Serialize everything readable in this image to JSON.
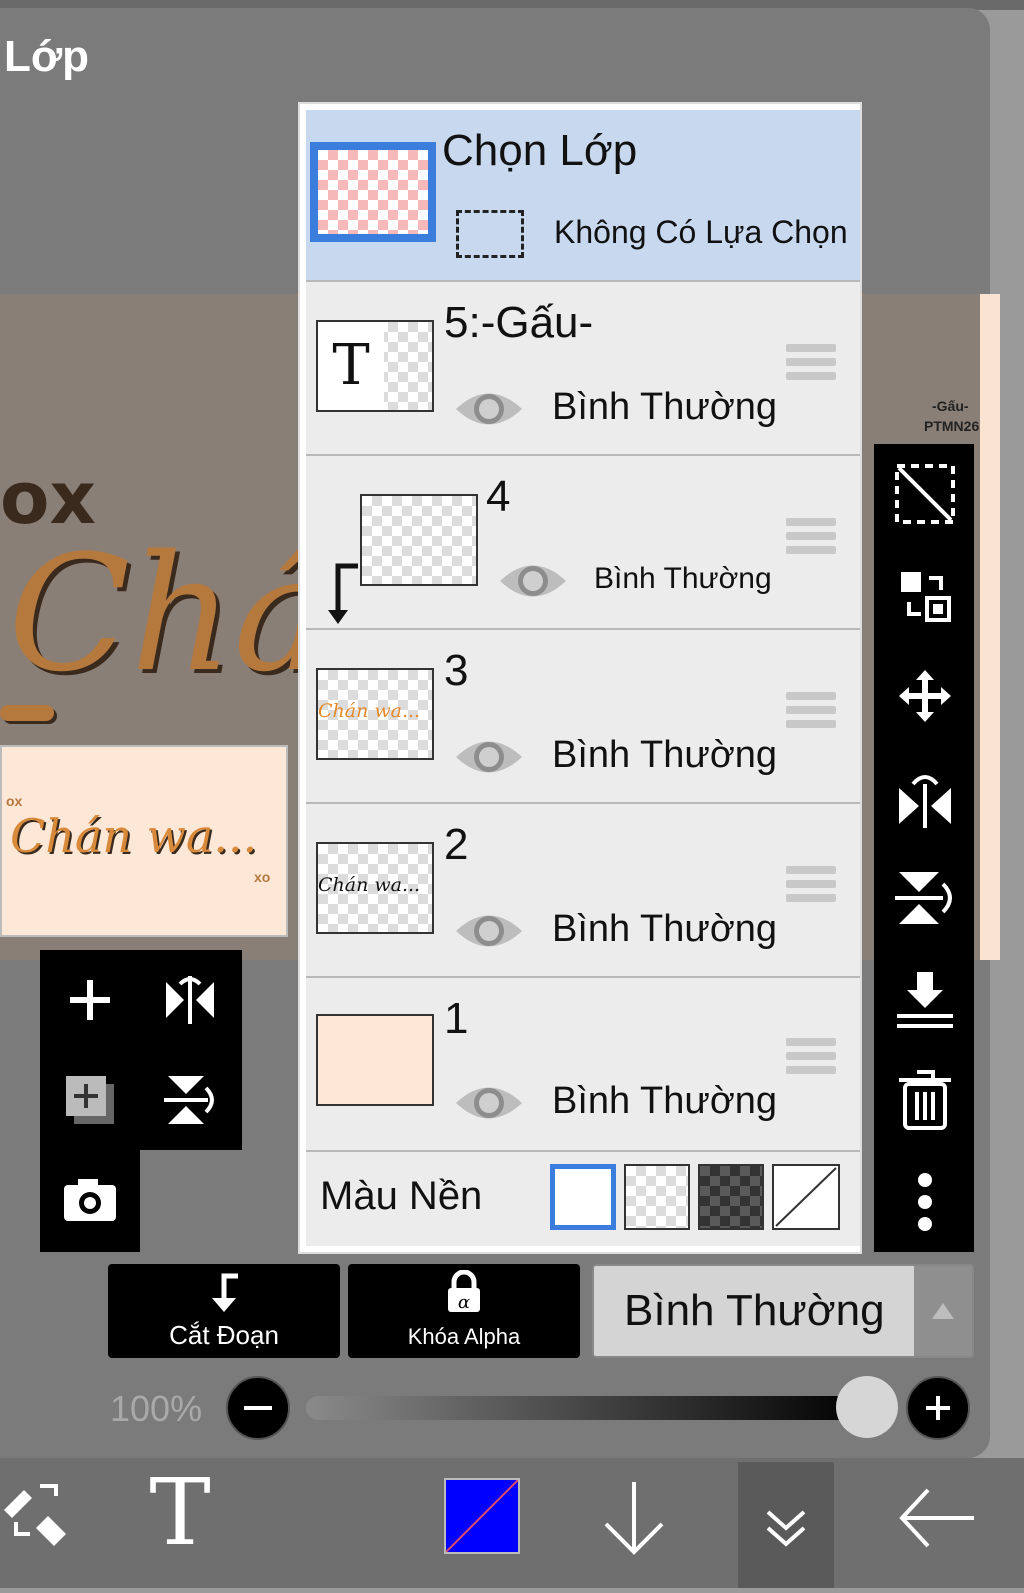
{
  "header": {
    "title": "Lớp"
  },
  "canvas": {
    "ox_text": "ox",
    "cho_text": "Chá",
    "preview_text": "Chán wa...",
    "preview_ox": "ox",
    "preview_xo": "xo",
    "side_label_1": "-Gấu-",
    "side_label_2": "PTMN26"
  },
  "selection": {
    "title": "Chọn Lớp",
    "status": "Không Có Lựa Chọn"
  },
  "layers": [
    {
      "name": "5:-Gấu-",
      "mode": "Bình Thường",
      "thumb_text": "T"
    },
    {
      "name": "4",
      "mode": "Bình Thường"
    },
    {
      "name": "3",
      "mode": "Bình Thường",
      "thumb_text": "Chán wa..."
    },
    {
      "name": "2",
      "mode": "Bình Thường",
      "thumb_text": "Chán wa..."
    },
    {
      "name": "1",
      "mode": "Bình Thường"
    }
  ],
  "background": {
    "label": "Màu Nền"
  },
  "bottom_controls": {
    "clip_label": "Cắt Đoạn",
    "alpha_lock_label": "Khóa Alpha",
    "blend_mode": "Bình Thường",
    "opacity_label": "100%",
    "opacity": 1.0
  },
  "colors": {
    "accent_blue": "#3a7ddc",
    "selection_bg": "#c8d8ee",
    "layer1_fill": "#fde8d8",
    "toolbar_bg": "#000000",
    "primary_color": "#0000ff"
  },
  "icons": [
    "selection-icon",
    "swap-icon",
    "move-icon",
    "flip-horizontal-icon",
    "flip-vertical-icon",
    "merge-down-icon",
    "trash-icon",
    "more-icon",
    "add-layer-icon",
    "copy-layer-icon",
    "camera-icon",
    "eye-icon",
    "drag-handle-icon",
    "clip-arrow-icon",
    "lock-icon",
    "brush-eraser-icon",
    "text-icon",
    "arrow-down-icon",
    "collapse-icon",
    "back-arrow-icon"
  ]
}
